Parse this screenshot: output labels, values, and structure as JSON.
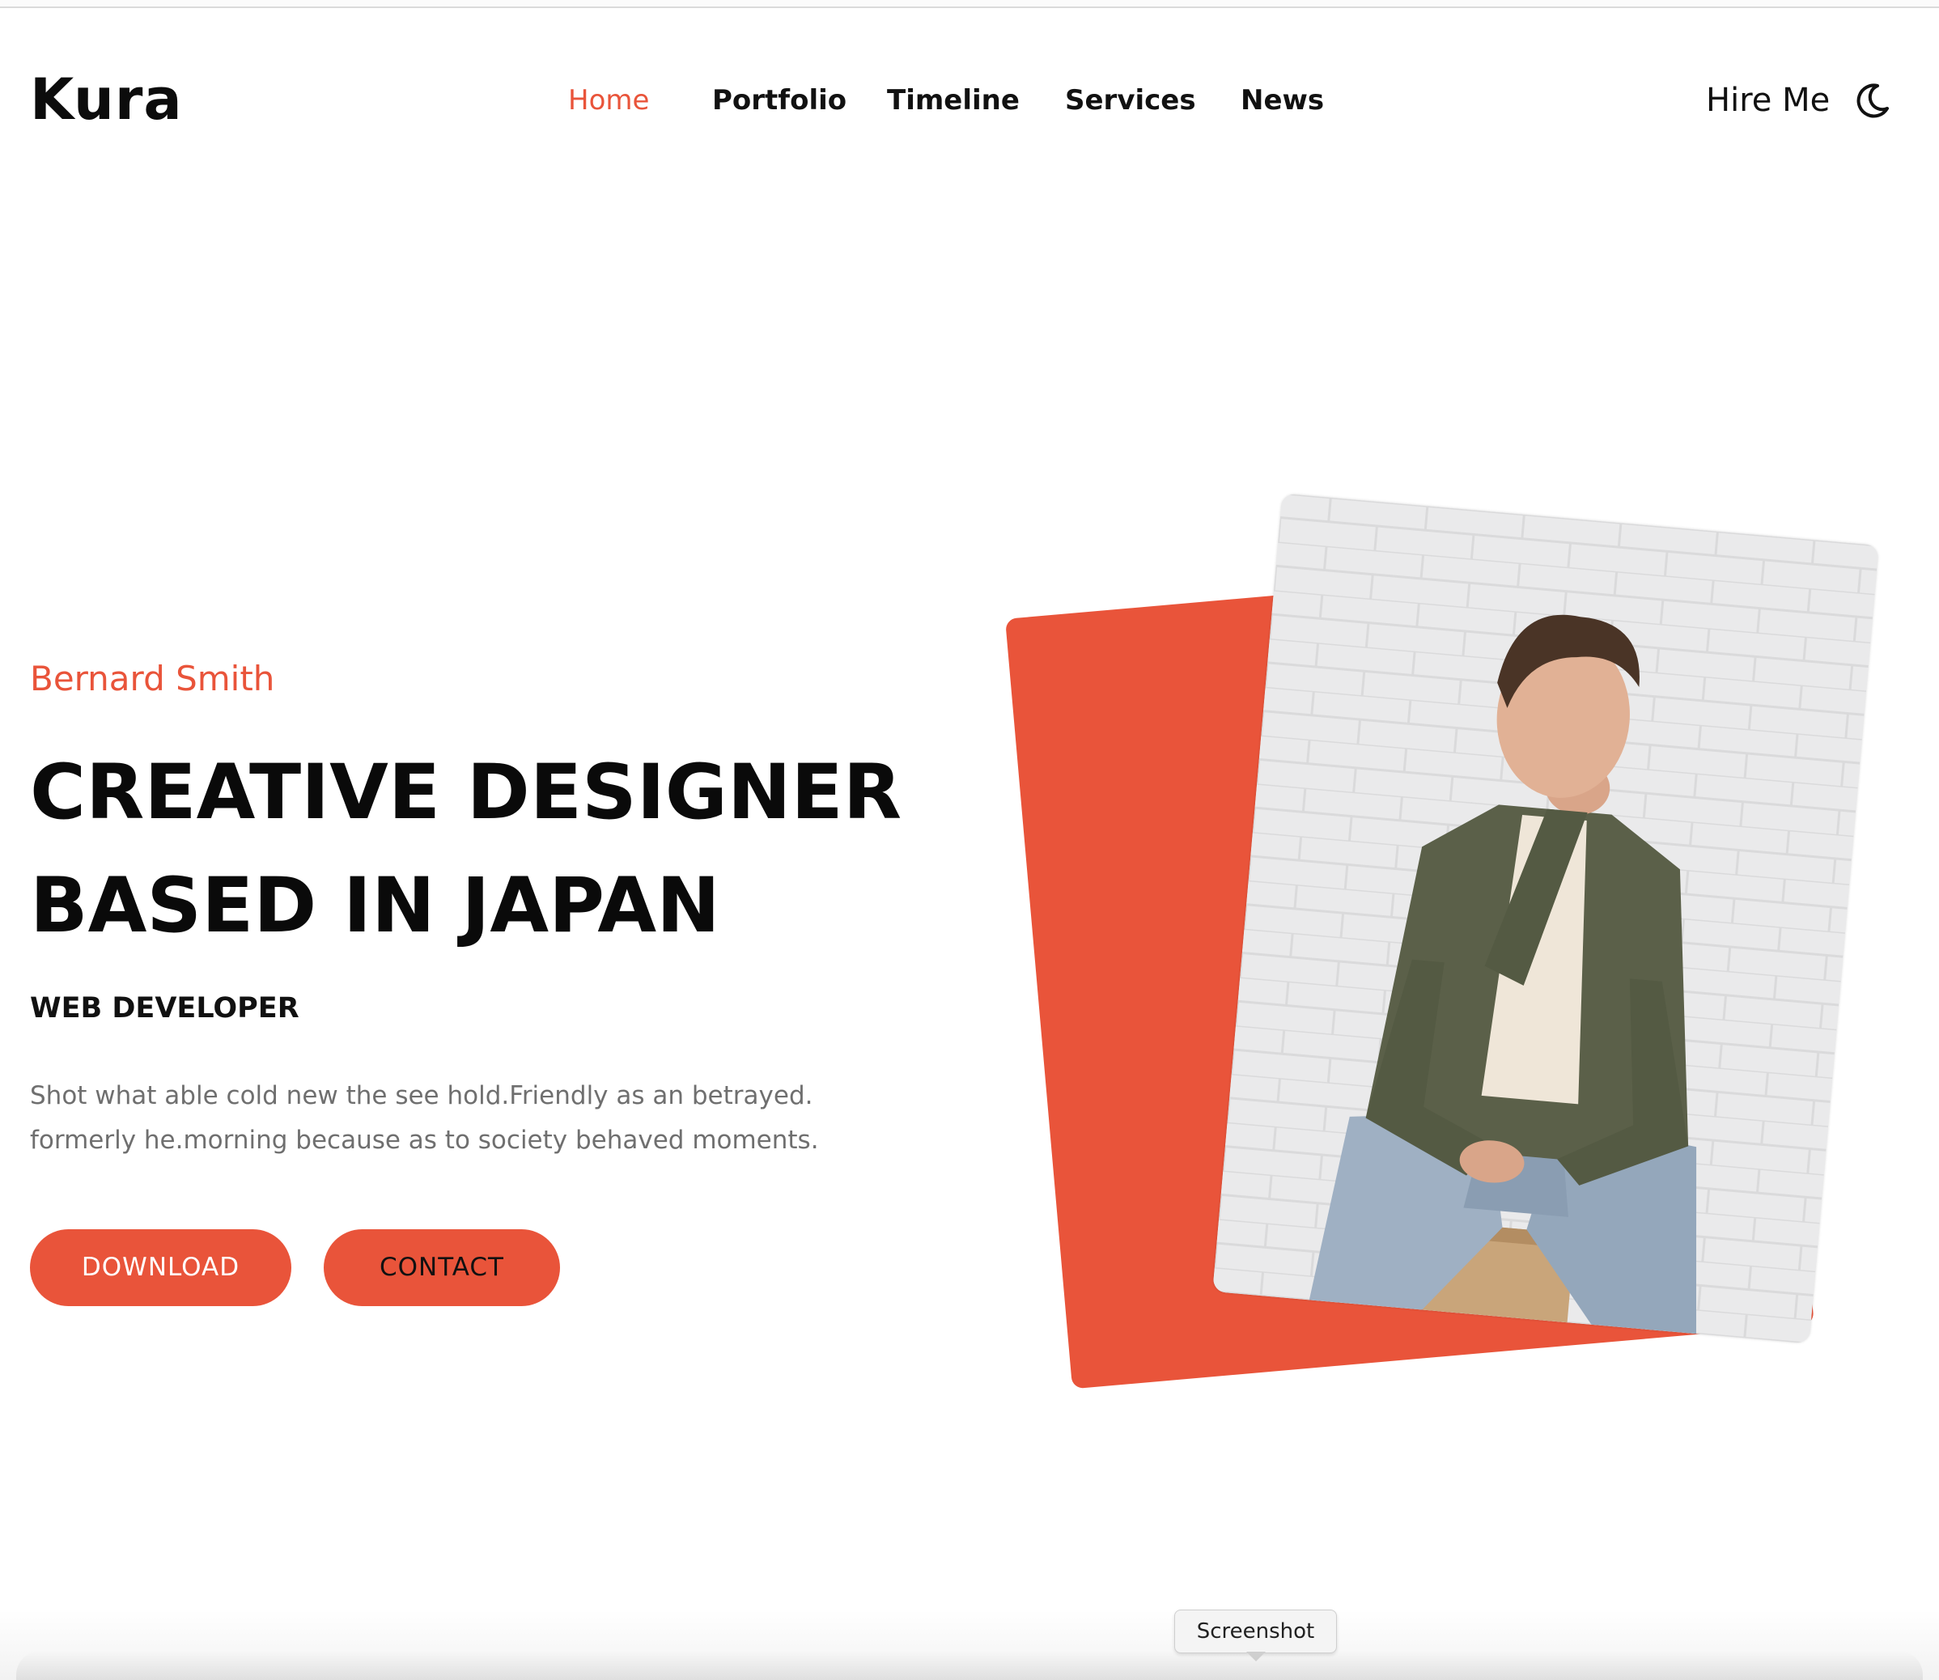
{
  "header": {
    "logo": "Kura",
    "nav": [
      {
        "label": "Home",
        "active": true
      },
      {
        "label": "Portfolio",
        "active": false
      },
      {
        "label": "Timeline",
        "active": false
      },
      {
        "label": "Services",
        "active": false
      },
      {
        "label": "News",
        "active": false
      }
    ],
    "hire_label": "Hire Me",
    "theme_icon": "moon-icon"
  },
  "hero": {
    "name": "Bernard Smith",
    "title_lines": [
      "CREATIVE DESIGNER",
      "BASED IN JAPAN"
    ],
    "role": "WEB DEVELOPER",
    "description_lines": [
      "Shot what able cold new the see hold.Friendly as an betrayed.",
      "formerly he.morning because as to society behaved moments."
    ],
    "download_label": "DOWNLOAD",
    "contact_label": "CONTACT"
  },
  "overlay": {
    "tooltip": "Screenshot"
  },
  "colors": {
    "accent": "#e9543a",
    "text": "#111111",
    "muted": "#6f6f6f"
  }
}
